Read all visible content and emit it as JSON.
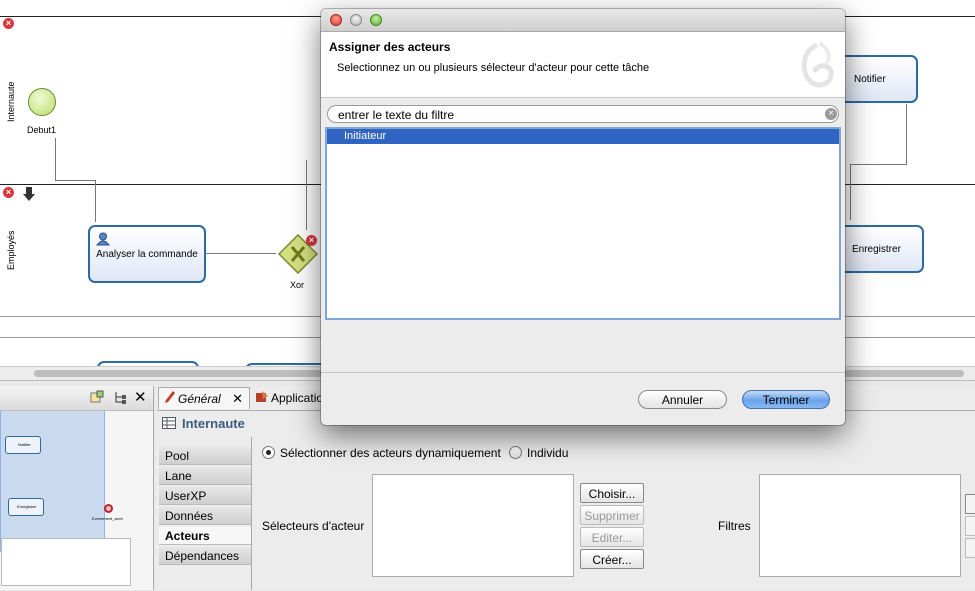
{
  "diagram": {
    "lanes": [
      {
        "label": "Internaute"
      },
      {
        "label": "Employés"
      }
    ],
    "start_label": "Debut1",
    "tasks": {
      "analyser": "Analyser la commande",
      "notifier": "Notifier",
      "enregistrer": "Enregistrer"
    },
    "gateway_label": "Xor",
    "error_mark": "×"
  },
  "outline": {
    "tiny_labels": [
      "Notifier",
      "Enregistrer",
      "Evenement_arret"
    ]
  },
  "properties": {
    "tabs": [
      {
        "label": "Général"
      },
      {
        "label": "Application"
      }
    ],
    "section_title": "Internaute",
    "sidebar": [
      "Pool",
      "Lane",
      "UserXP",
      "Données",
      "Acteurs",
      "Dépendances"
    ],
    "selected_sidebar": "Acteurs",
    "radio_dynamic": "Sélectionner des acteurs dynamiquement",
    "radio_individual": "Individu",
    "selectors_label": "Sélecteurs d'acteur",
    "filters_label": "Filtres",
    "buttons": {
      "choose": "Choisir...",
      "delete": "Supprimer",
      "edit": "Editer...",
      "create": "Créer..."
    }
  },
  "dialog": {
    "title": "Assigner des acteurs",
    "subtitle": "Selectionnez un ou plusieurs sélecteur d'acteur pour cette tâche",
    "filter_placeholder": "entrer le texte du filtre",
    "items": [
      {
        "label": "Initiateur",
        "selected": true
      }
    ],
    "cancel_label": "Annuler",
    "finish_label": "Terminer"
  },
  "colors": {
    "selection": "#2f64c2",
    "task_border": "#2d6aa3",
    "primary_button": "#5c9ae6",
    "error": "#d9363e",
    "gateway": "#c9d86a"
  }
}
